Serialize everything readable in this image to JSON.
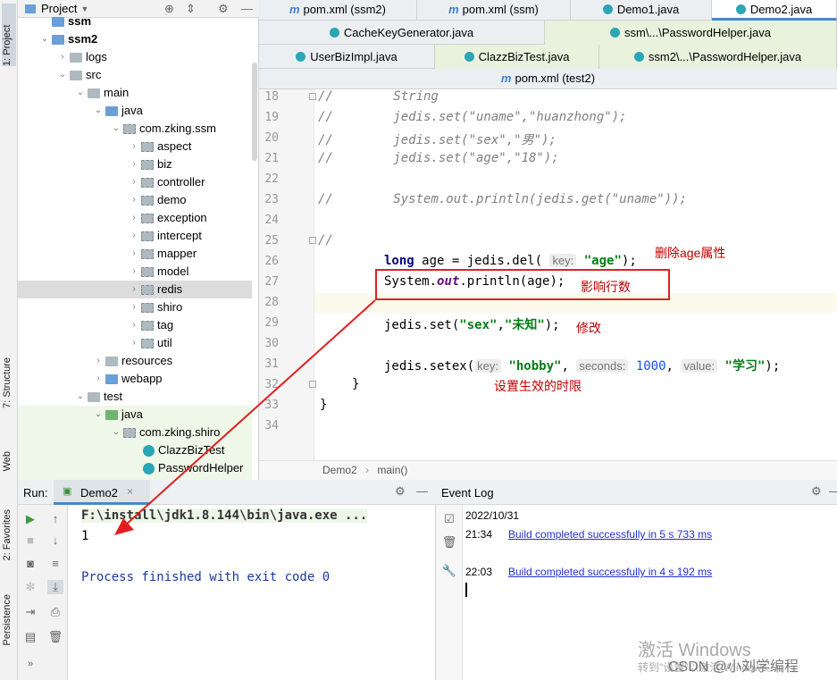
{
  "left_strip": {
    "project": "1: Project",
    "structure": "7: Structure",
    "web": "Web",
    "favorites": "2: Favorites",
    "persistence": "Persistence"
  },
  "project_panel": {
    "title": "Project",
    "tree": [
      {
        "label": "ssm"
      },
      {
        "label": "ssm2"
      },
      {
        "label": "logs"
      },
      {
        "label": "src"
      },
      {
        "label": "main"
      },
      {
        "label": "java"
      },
      {
        "label": "com.zking.ssm"
      },
      {
        "label": "aspect"
      },
      {
        "label": "biz"
      },
      {
        "label": "controller"
      },
      {
        "label": "demo"
      },
      {
        "label": "exception"
      },
      {
        "label": "intercept"
      },
      {
        "label": "mapper"
      },
      {
        "label": "model"
      },
      {
        "label": "redis"
      },
      {
        "label": "shiro"
      },
      {
        "label": "tag"
      },
      {
        "label": "util"
      },
      {
        "label": "resources"
      },
      {
        "label": "webapp"
      },
      {
        "label": "test"
      },
      {
        "label": "java"
      },
      {
        "label": "com.zking.shiro"
      },
      {
        "label": "ClazzBizTest"
      },
      {
        "label": "PasswordHelper"
      }
    ]
  },
  "tabs": {
    "row1": [
      "pom.xml (ssm2)",
      "pom.xml (ssm)",
      "Demo1.java",
      "Demo2.java"
    ],
    "row2": [
      "CacheKeyGenerator.java",
      "ssm\\...\\PasswordHelper.java"
    ],
    "row3": [
      "UserBizImpl.java",
      "ClazzBizTest.java",
      "ssm2\\...\\PasswordHelper.java"
    ],
    "row4": [
      "pom.xml (test2)"
    ]
  },
  "editor": {
    "line_numbers": [
      "18",
      "19",
      "20",
      "21",
      "22",
      "23",
      "24",
      "25",
      "26",
      "27",
      "28",
      "29",
      "30",
      "31",
      "32",
      "33",
      "34"
    ],
    "lines": {
      "l18": "//        String",
      "l19": "//        jedis.set(\"uname\",\"huanzhong\");",
      "l20": "//        jedis.set(\"sex\",\"男\");",
      "l21": "//        jedis.set(\"age\",\"18\");",
      "l23": "//        System.out.println(jedis.get(\"uname\"));",
      "l25": "//",
      "l26_a": "long",
      "l26_b": " age = jedis.del(",
      "l26_hint": "key:",
      "l26_c": "\"age\"",
      "l26_d": ");",
      "l27_a": "System.",
      "l27_b": "out",
      "l27_c": ".println(age);",
      "l29_a": "jedis.set(",
      "l29_b": "\"sex\"",
      "l29_c": ",",
      "l29_d": "\"未知\"",
      "l29_e": ");",
      "l31_a": "jedis.setex(",
      "l31_hint1": "key:",
      "l31_b": "\"hobby\"",
      "l31_c": ",",
      "l31_hint2": "seconds:",
      "l31_d": "1000",
      "l31_e": ",",
      "l31_hint3": "value:",
      "l31_f": "\"学习\"",
      "l31_g": ");",
      "l32": "}",
      "l33": "}"
    },
    "annotations": {
      "del": "删除age属性",
      "rows": "影响行数",
      "modify": "修改",
      "expire": "设置生效的时限"
    },
    "breadcrumb": [
      "Demo2",
      "main()"
    ]
  },
  "run_panel": {
    "label": "Run:",
    "tab": "Demo2",
    "console": [
      "F:\\install\\jdk1.8.144\\bin\\java.exe ...",
      "1",
      "",
      "Process finished with exit code 0"
    ]
  },
  "event_log": {
    "title": "Event Log",
    "date": "2022/10/31",
    "entries": [
      {
        "time": "21:34",
        "message": "Build completed successfully in 5 s 733 ms"
      },
      {
        "time": "22:03",
        "message": "Build completed successfully in 4 s 192 ms"
      }
    ]
  },
  "watermark": {
    "windows": "激活 Windows",
    "windows_sub": "转到\"设置\"以激活 Windows。",
    "csdn": "CSDN @小刘学编程"
  }
}
